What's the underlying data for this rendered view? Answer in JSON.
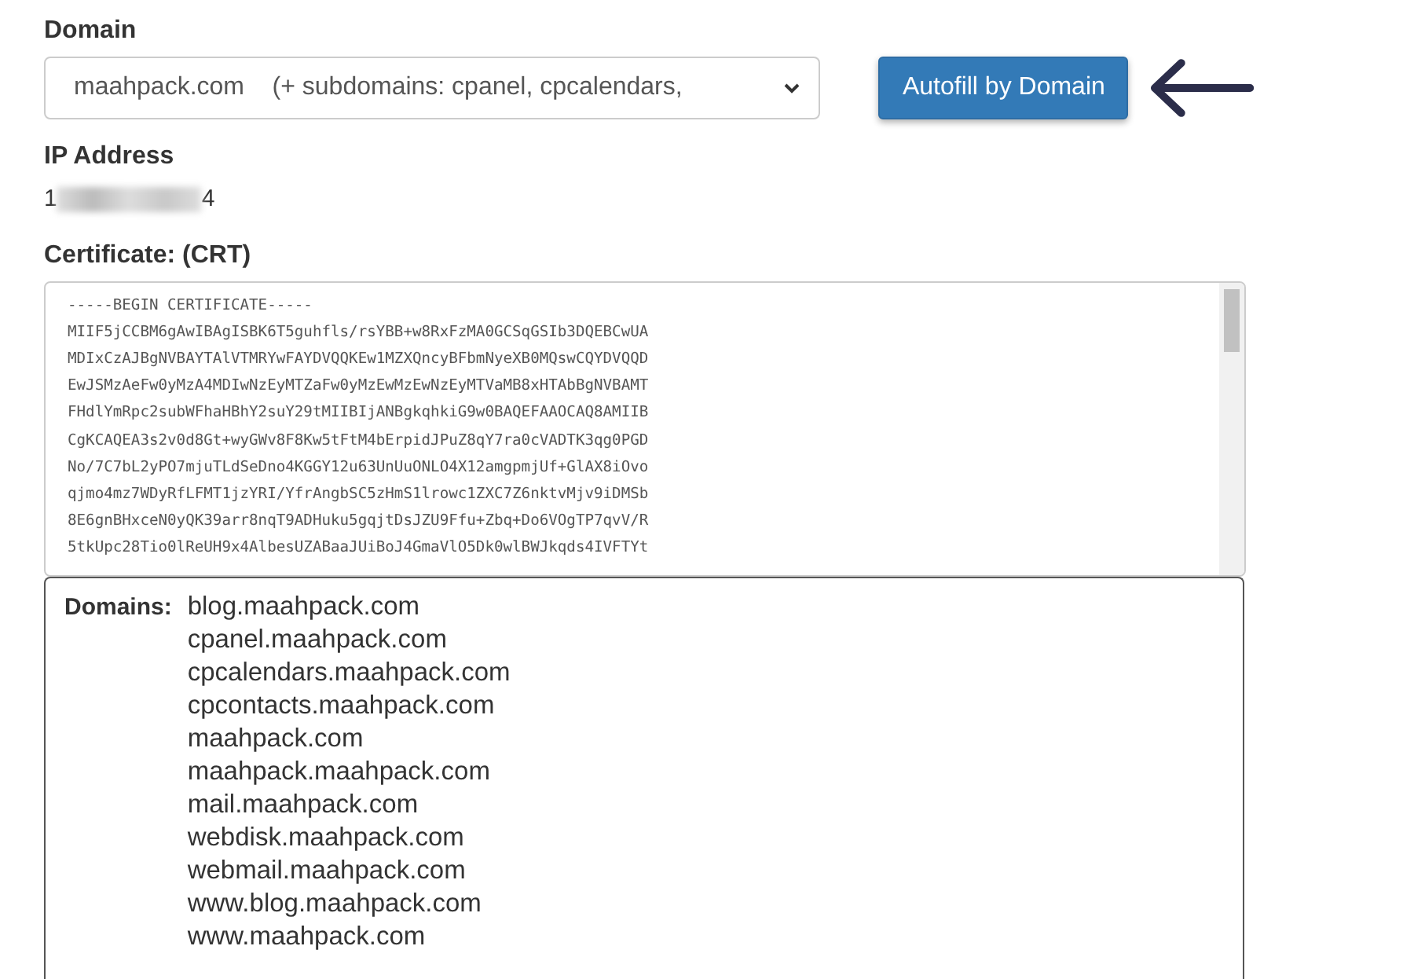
{
  "domain": {
    "label": "Domain",
    "value": "maahpack.com    (+ subdomains: cpanel, cpcalendars,"
  },
  "autofill_button": {
    "label": "Autofill by Domain"
  },
  "ip_address": {
    "label": "IP Address",
    "prefix": "1",
    "suffix": "4"
  },
  "certificate": {
    "label": "Certificate: (CRT)",
    "lines": [
      "-----BEGIN CERTIFICATE-----",
      "MIIF5jCCBM6gAwIBAgISBK6T5guhfls/rsYBB+w8RxFzMA0GCSqGSIb3DQEBCwUA",
      "MDIxCzAJBgNVBAYTAlVTMRYwFAYDVQQKEw1MZXQncyBFbmNyeXB0MQswCQYDVQQD",
      "EwJSMzAeFw0yMzA4MDIwNzEyMTZaFw0yMzEwMzEwNzEyMTVaMB8xHTAbBgNVBAMT",
      "FHdlYmRpc2subWFhaHBhY2suY29tMIIBIjANBgkqhkiG9w0BAQEFAAOCAQ8AMIIB",
      "CgKCAQEA3s2v0d8Gt+wyGWv8F8Kw5tFtM4bErpidJPuZ8qY7ra0cVADTK3qg0PGD",
      "No/7C7bL2yPO7mjuTLdSeDno4KGGY12u63UnUuONLO4X12amgpmjUf+GlAX8iOvo",
      "qjmo4mz7WDyRfLFMT1jzYRI/YfrAngbSC5zHmS1lrowc1ZXC7Z6nktvMjv9iDMSb",
      "8E6gnBHxceN0yQK39arr8nqT9ADHuku5gqjtDsJZU9Ffu+Zbq+Do6VOgTP7qvV/R",
      "5tkUpc28Tio0lReUH9x4AlbesUZABaaJUiBoJ4GmaVlO5Dk0wlBWJkqds4IVFTYt"
    ]
  },
  "domains_popup": {
    "label": "Domains:",
    "items": [
      "blog.maahpack.com",
      "cpanel.maahpack.com",
      "cpcalendars.maahpack.com",
      "cpcontacts.maahpack.com",
      "maahpack.com",
      "maahpack.maahpack.com",
      "mail.maahpack.com",
      "webdisk.maahpack.com",
      "webmail.maahpack.com",
      "www.blog.maahpack.com",
      "www.maahpack.com"
    ]
  }
}
